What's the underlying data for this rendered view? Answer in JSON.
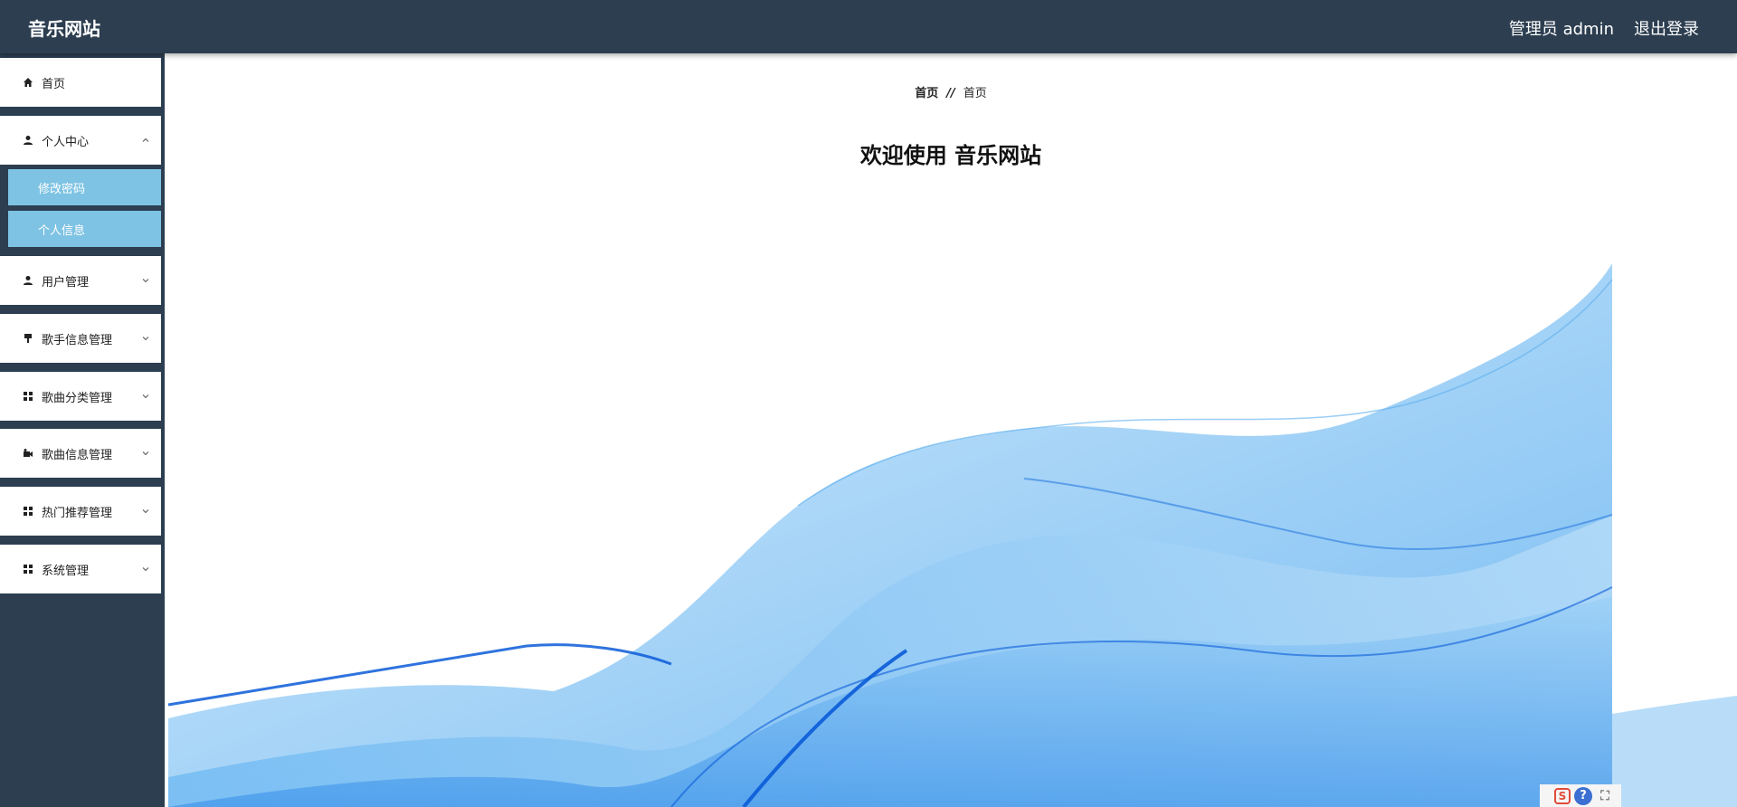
{
  "header": {
    "brand": "音乐网站",
    "user_label": "管理员 admin",
    "logout_label": "退出登录"
  },
  "sidebar": {
    "items": [
      {
        "label": "首页",
        "icon": "home-icon"
      },
      {
        "label": "个人中心",
        "icon": "user-icon",
        "expanded": true,
        "children": [
          {
            "label": "修改密码"
          },
          {
            "label": "个人信息"
          }
        ]
      },
      {
        "label": "用户管理",
        "icon": "user-icon"
      },
      {
        "label": "歌手信息管理",
        "icon": "brush-icon"
      },
      {
        "label": "歌曲分类管理",
        "icon": "grid-icon"
      },
      {
        "label": "歌曲信息管理",
        "icon": "video-icon"
      },
      {
        "label": "热门推荐管理",
        "icon": "grid-icon"
      },
      {
        "label": "系统管理",
        "icon": "grid-icon"
      }
    ]
  },
  "main": {
    "breadcrumb": [
      "首页",
      "首页"
    ],
    "breadcrumb_separator": "//",
    "welcome": "欢迎使用 音乐网站"
  },
  "tools": {
    "s_label": "S",
    "help_label": "?",
    "fullscreen_label": "⛶"
  },
  "colors": {
    "header_bg": "#2c3e50",
    "submenu_bg": "#7ec3e3",
    "wave_light": "#a9d6f5",
    "wave_dark": "#0a5bd8"
  }
}
